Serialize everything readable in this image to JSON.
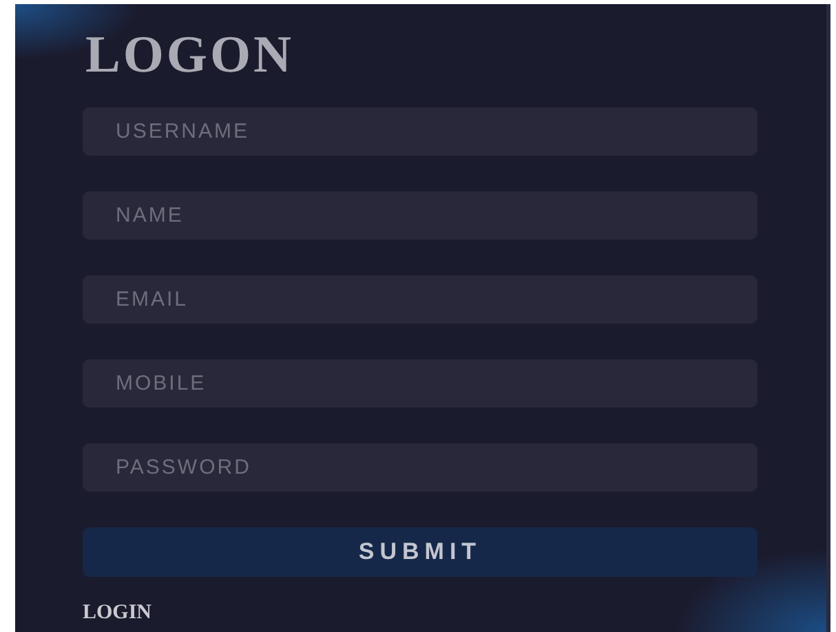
{
  "title": "LOGON",
  "fields": [
    {
      "placeholder": "USERNAME"
    },
    {
      "placeholder": "NAME"
    },
    {
      "placeholder": "EMAIL"
    },
    {
      "placeholder": "MOBILE"
    },
    {
      "placeholder": "PASSWORD"
    }
  ],
  "submit": "SUBMIT",
  "login_link": "LOGIN"
}
